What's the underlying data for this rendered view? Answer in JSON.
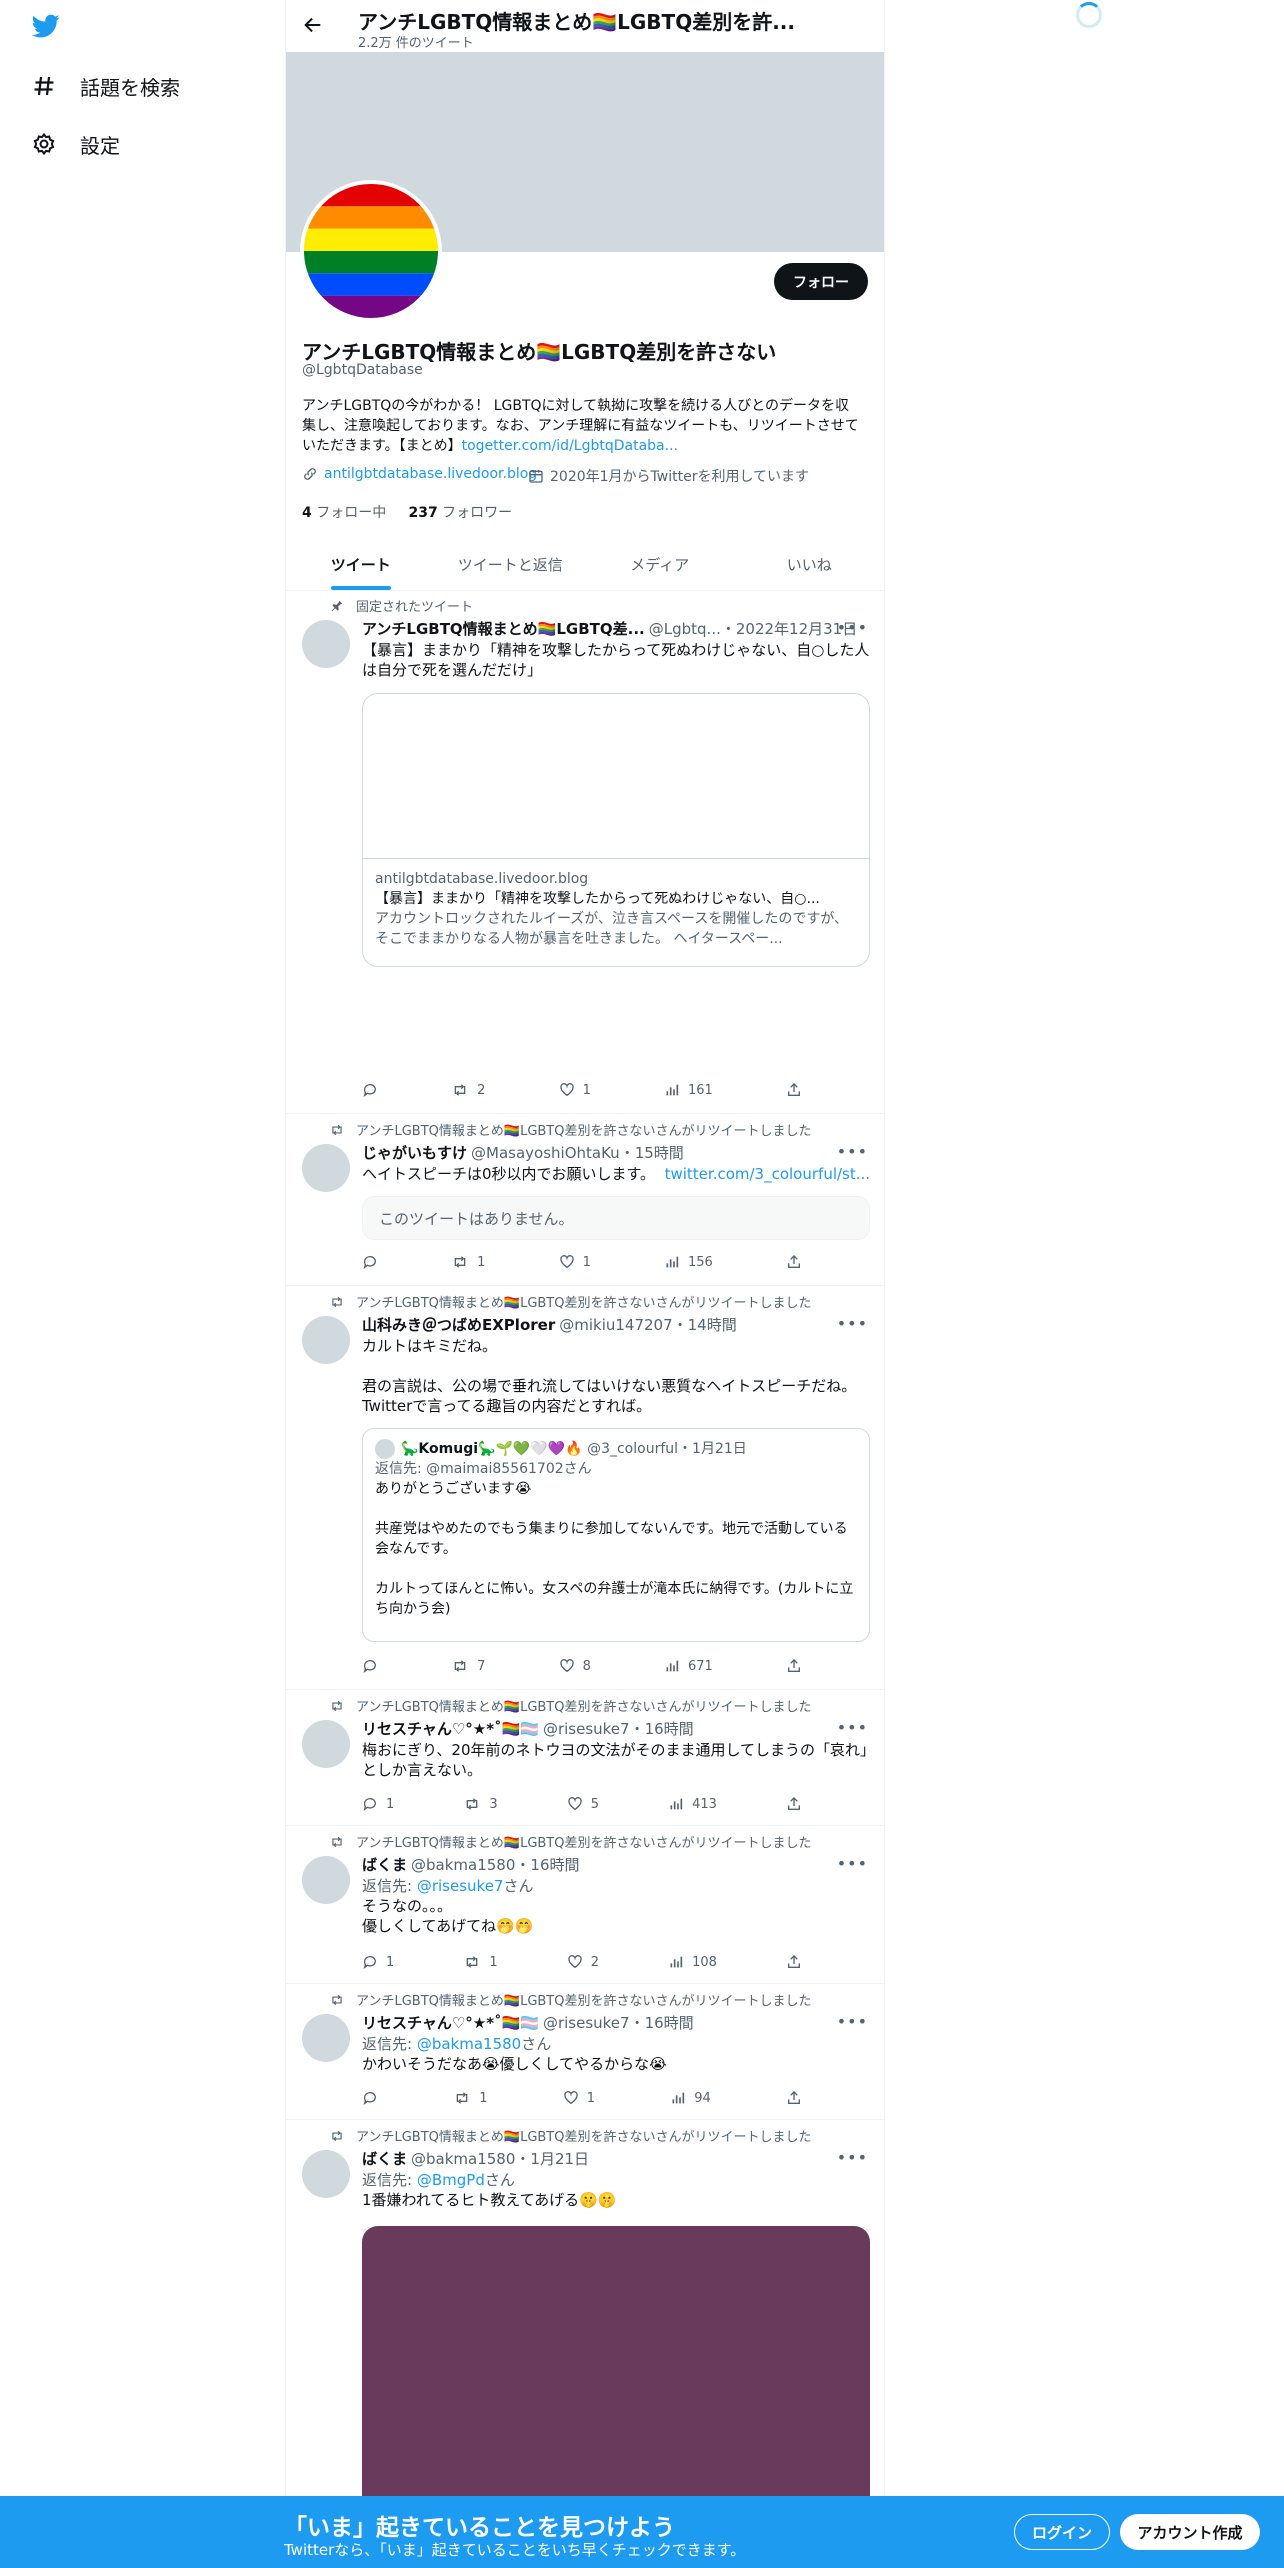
{
  "nav": {
    "explore_label": "話題を検索",
    "settings_label": "設定"
  },
  "header": {
    "title": "アンチLGBTQ情報まとめ🏳️‍🌈LGBTQ差別を許...",
    "tweet_count": "2.2万 件のツイート"
  },
  "profile": {
    "follow_label": "フォロー",
    "name": "アンチLGBTQ情報まとめ🏳️‍🌈LGBTQ差別を許さない",
    "handle": "@LgbtqDatabase",
    "bio_text": "アンチLGBTQの今がわかる！ LGBTQに対して執拗に攻撃を続ける人びとのデータを収集し、注意喚起しております。なお、アンチ理解に有益なツイートも、リツイートさせていただきます。【まとめ】",
    "bio_link": "togetter.com/id/LgbtqDataba...",
    "website": "antilgbtdatabase.livedoor.blog",
    "joined": "2020年1月からTwitterを利用しています",
    "following_count": "4",
    "following_label": "フォロー中",
    "followers_count": "237",
    "followers_label": "フォロワー"
  },
  "tabs": [
    "ツイート",
    "ツイートと返信",
    "メディア",
    "いいね"
  ],
  "retweet_context": "アンチLGBTQ情報まとめ🏳️‍🌈LGBTQ差別を許さないさんがリツイートしました",
  "pinned_label": "固定されたツイート",
  "reply_prefix": "返信先:",
  "reply_suffix": "さん",
  "more": "•••",
  "tweets": [
    {
      "name": "アンチLGBTQ情報まとめ🏳️‍🌈LGBTQ差...",
      "handle": "@Lgbtq...",
      "time": "・2022年12月31日",
      "text": "【暴言】ままかり「精神を攻撃したからって死ぬわけじゃない、自○した人は自分で死を選んだだけ」",
      "card": {
        "domain": "antilgbtdatabase.livedoor.blog",
        "title": "【暴言】ままかり「精神を攻撃したからって死ぬわけじゃない、自○...",
        "desc": "アカウントロックされたルイーズが、泣き言スペースを開催したのですが、そこでままかりなる人物が暴言を吐きました。 ヘイタースペー..."
      },
      "replies": "",
      "retweets": "2",
      "likes": "1",
      "views": "161"
    },
    {
      "name": "じゃがいもすけ",
      "handle": "@MasayoshiOhtaKu",
      "time": "・15時間",
      "text": "ヘイトスピーチは0秒以内でお願いします。",
      "link": "twitter.com/3_colourful/st...",
      "unavailable": "このツイートはありません。",
      "replies": "",
      "retweets": "1",
      "likes": "1",
      "views": "156"
    },
    {
      "name": "山科みき＠つばめEXPlorer",
      "handle": "@mikiu147207",
      "time": "・14時間",
      "text": "カルトはキミだね。\n\n君の言説は、公の場で垂れ流してはいけない悪質なヘイトスピーチだね。\nTwitterで言ってる趣旨の内容だとすれば。",
      "quote": {
        "name": "🦕Komugi🦕🌱💚🤍💜🔥",
        "handle": "@3_colourful",
        "time": "・1月21日",
        "reply_to": "@maimai85561702",
        "text": "ありがとうございます😭\n\n共産党はやめたのでもう集まりに参加してないんです。地元で活動している会なんです。\n\nカルトってほんとに怖い。女スペの弁護士が滝本氏に納得です。(カルトに立ち向かう会)"
      },
      "replies": "",
      "retweets": "7",
      "likes": "8",
      "views": "671"
    },
    {
      "name": "リセスチャん♡°★*˚🏳️‍🌈🏳️‍⚧️",
      "handle": "@risesuke7",
      "time": "・16時間",
      "text": "梅おにぎり、20年前のネトウヨの文法がそのまま通用してしまうの「哀れ」としか言えない。",
      "replies": "1",
      "retweets": "3",
      "likes": "5",
      "views": "413"
    },
    {
      "name": "ばくま",
      "handle": "@bakma1580",
      "time": "・16時間",
      "reply_to": "@risesuke7",
      "text": "そうなの。。。\n優しくしてあげてね🤭🤭",
      "replies": "1",
      "retweets": "1",
      "likes": "2",
      "views": "108"
    },
    {
      "name": "リセスチャん♡°★*˚🏳️‍🌈🏳️‍⚧️",
      "handle": "@risesuke7",
      "time": "・16時間",
      "reply_to": "@bakma1580",
      "text": "かわいそうだなあ😭優しくしてやるからな😭",
      "replies": "",
      "retweets": "1",
      "likes": "1",
      "views": "94"
    },
    {
      "name": "ばくま",
      "handle": "@bakma1580",
      "time": "・1月21日",
      "reply_to": "@BmgPd",
      "text": "1番嫌われてるヒト教えてあげる🤫🤫"
    }
  ],
  "bottom_bar": {
    "title": "「いま」起きていることを見つけよう",
    "subtitle": "Twitterなら、「いま」起きていることをいち早くチェックできます。",
    "login_label": "ログイン",
    "signup_label": "アカウント作成"
  },
  "colors": {
    "accent": "#1d9bf0",
    "media_placeholder": "#6a3a5c"
  }
}
